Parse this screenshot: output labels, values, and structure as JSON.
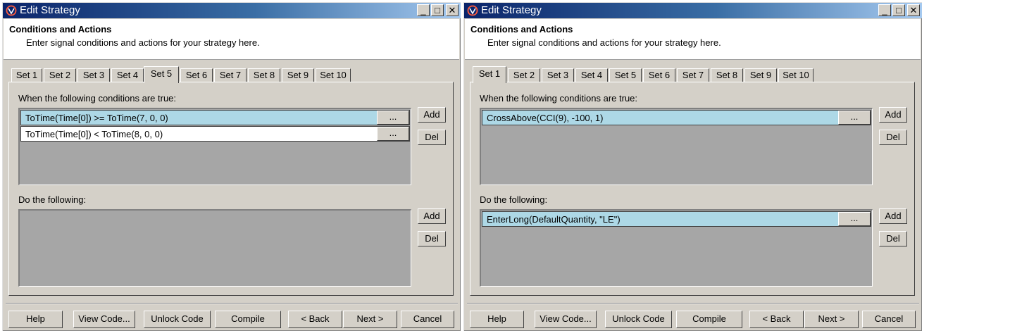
{
  "windows": [
    {
      "title": "Edit Strategy",
      "controls": {
        "minimize": "_",
        "maximize": "□",
        "close": "✕"
      },
      "header": {
        "title": "Conditions and Actions",
        "subtitle": "Enter signal conditions and actions for your strategy here."
      },
      "tabs": [
        {
          "label": "Set 1",
          "active": false
        },
        {
          "label": "Set 2",
          "active": false
        },
        {
          "label": "Set 3",
          "active": false
        },
        {
          "label": "Set 4",
          "active": false
        },
        {
          "label": "Set 5",
          "active": true
        },
        {
          "label": "Set 6",
          "active": false
        },
        {
          "label": "Set 7",
          "active": false
        },
        {
          "label": "Set 8",
          "active": false
        },
        {
          "label": "Set 9",
          "active": false
        },
        {
          "label": "Set 10",
          "active": false
        }
      ],
      "conditions": {
        "label": "When the following conditions are true:",
        "rows": [
          {
            "text": "ToTime(Time[0]) >= ToTime(7, 0, 0)",
            "button": "...",
            "selected": true
          },
          {
            "text": "ToTime(Time[0]) < ToTime(8, 0, 0)",
            "button": "...",
            "selected": false
          }
        ],
        "add": "Add",
        "del": "Del"
      },
      "actions": {
        "label": "Do the following:",
        "rows": [],
        "add": "Add",
        "del": "Del"
      },
      "buttons": {
        "help": "Help",
        "view_code": "View Code...",
        "unlock_code": "Unlock Code",
        "compile": "Compile",
        "back": "< Back",
        "next": "Next >",
        "cancel": "Cancel"
      }
    },
    {
      "title": "Edit Strategy",
      "controls": {
        "minimize": "_",
        "maximize": "□",
        "close": "✕"
      },
      "header": {
        "title": "Conditions and Actions",
        "subtitle": "Enter signal conditions and actions for your strategy here."
      },
      "tabs": [
        {
          "label": "Set 1",
          "active": true
        },
        {
          "label": "Set 2",
          "active": false
        },
        {
          "label": "Set 3",
          "active": false
        },
        {
          "label": "Set 4",
          "active": false
        },
        {
          "label": "Set 5",
          "active": false
        },
        {
          "label": "Set 6",
          "active": false
        },
        {
          "label": "Set 7",
          "active": false
        },
        {
          "label": "Set 8",
          "active": false
        },
        {
          "label": "Set 9",
          "active": false
        },
        {
          "label": "Set 10",
          "active": false
        }
      ],
      "conditions": {
        "label": "When the following conditions are true:",
        "rows": [
          {
            "text": "CrossAbove(CCI(9), -100, 1)",
            "button": "...",
            "selected": true
          }
        ],
        "add": "Add",
        "del": "Del"
      },
      "actions": {
        "label": "Do the following:",
        "rows": [
          {
            "text": "EnterLong(DefaultQuantity, \"LE\")",
            "button": "...",
            "selected": true
          }
        ],
        "add": "Add",
        "del": "Del"
      },
      "buttons": {
        "help": "Help",
        "view_code": "View Code...",
        "unlock_code": "Unlock Code",
        "compile": "Compile",
        "back": "< Back",
        "next": "Next >",
        "cancel": "Cancel"
      }
    }
  ],
  "colors": {
    "titlebar_start": "#0a246a",
    "titlebar_end": "#a6caf0",
    "selected_row": "#add8e6",
    "dialog_face": "#d4d0c8",
    "list_empty": "#a6a6a6"
  }
}
